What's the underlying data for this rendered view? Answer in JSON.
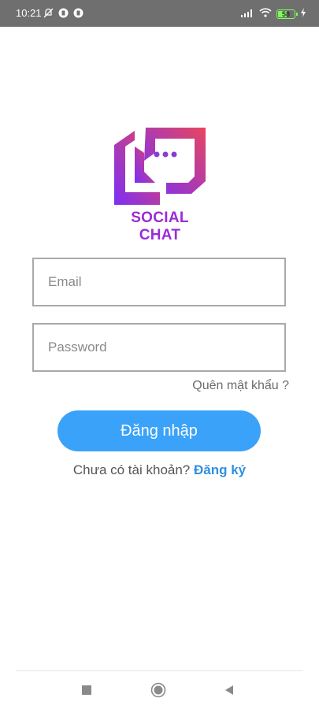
{
  "status_bar": {
    "time": "10:21",
    "battery_level": "58",
    "battery_fraction": 0.58,
    "left_icons": [
      "muted-icon",
      "app-notification-icon",
      "app-notification-icon"
    ],
    "right_icons": [
      "signal-icon",
      "wifi-icon",
      "battery-icon",
      "charging-icon"
    ]
  },
  "logo": {
    "text": "SOCIAL CHAT",
    "gradient_start": "#e8465e",
    "gradient_end": "#7b2ff7"
  },
  "form": {
    "email_placeholder": "Email",
    "password_placeholder": "Password",
    "forgot_password": "Quên mật khẩu ?",
    "login_button": "Đăng nhập",
    "no_account_prompt": "Chưa có tài khoản?",
    "signup_link": "Đăng ký"
  },
  "colors": {
    "accent": "#3aa2f9",
    "link": "#2f8fe0",
    "status_bar_bg": "#6f6f6f"
  },
  "nav_bar": {
    "buttons": [
      "recent-apps-icon",
      "home-icon",
      "back-icon"
    ]
  }
}
